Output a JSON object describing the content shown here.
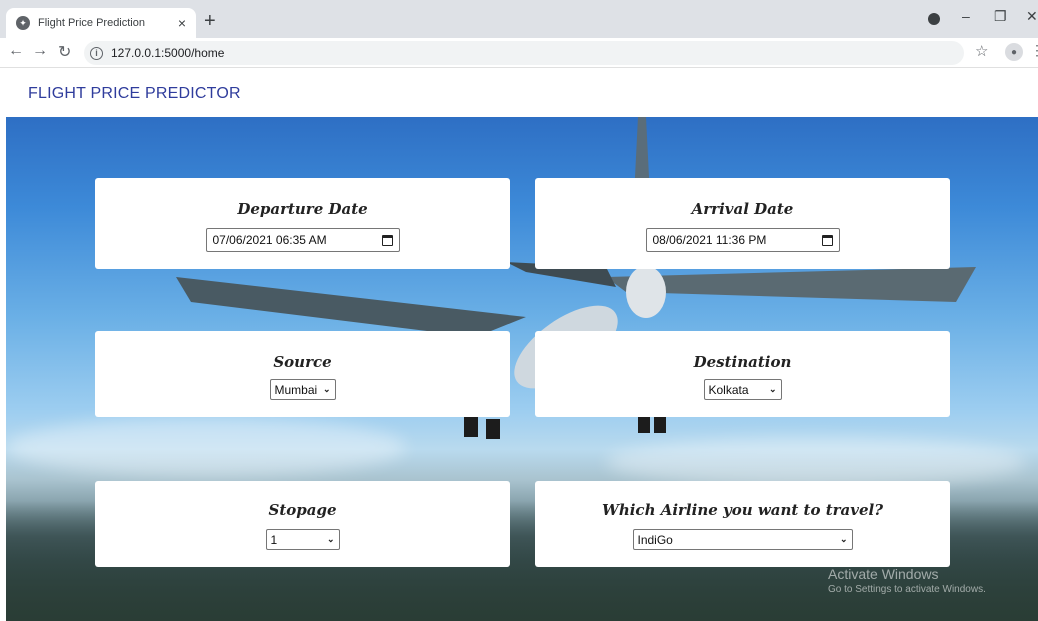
{
  "browser": {
    "tab_title": "Flight Price Prediction",
    "tab_close": "×",
    "new_tab": "+",
    "url": "127.0.0.1:5000/home",
    "info": "i"
  },
  "page": {
    "brand": "FLIGHT PRICE PREDICTOR"
  },
  "form": {
    "departure": {
      "label": "Departure Date",
      "value": "07/06/2021 06:35 AM"
    },
    "arrival": {
      "label": "Arrival Date",
      "value": "08/06/2021 11:36 PM"
    },
    "source": {
      "label": "Source",
      "value": "Mumbai"
    },
    "destination": {
      "label": "Destination",
      "value": "Kolkata"
    },
    "stopage": {
      "label": "Stopage",
      "value": "1"
    },
    "airline": {
      "label": "Which Airline you want to travel?",
      "value": "IndiGo"
    }
  },
  "watermark": {
    "line1": "Activate Windows",
    "line2": "Go to Settings to activate Windows."
  },
  "colors": {
    "brand": "#2f3c9c",
    "tab_bg": "#dee1e6",
    "sky_top": "#2e6fc4"
  },
  "icons": [
    "back-icon",
    "forward-icon",
    "reload-icon",
    "info-icon",
    "star-icon",
    "avatar-icon",
    "calendar-icon",
    "chevron-down-icon"
  ]
}
